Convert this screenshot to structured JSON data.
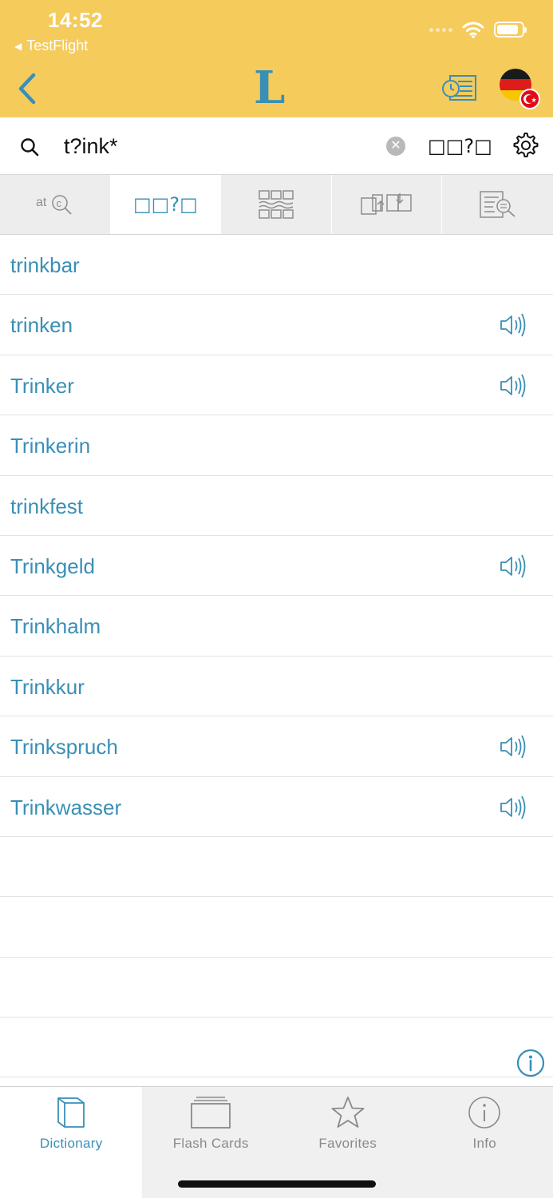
{
  "status_bar": {
    "time": "14:52",
    "back_app": "TestFlight"
  },
  "header": {
    "logo": "L",
    "back_icon": "chevron-left-icon",
    "history_icon": "history-list-icon",
    "language_flags": [
      "de",
      "tr"
    ]
  },
  "search": {
    "query": "t?ink*",
    "mode_label": "□□?□"
  },
  "tabs": [
    {
      "name": "tab-spelling-search",
      "icon": "abc-search-icon"
    },
    {
      "name": "tab-wildcard",
      "label": "□□?□",
      "active": true
    },
    {
      "name": "tab-fulltext",
      "icon": "grid-wave-icon"
    },
    {
      "name": "tab-translation",
      "icon": "translate-icon"
    },
    {
      "name": "tab-text-search",
      "icon": "document-search-icon"
    }
  ],
  "results": [
    {
      "word": "trinkbar",
      "audio": false
    },
    {
      "word": "trinken",
      "audio": true
    },
    {
      "word": "Trinker",
      "audio": true
    },
    {
      "word": "Trinkerin",
      "audio": false
    },
    {
      "word": "trinkfest",
      "audio": false
    },
    {
      "word": "Trinkgeld",
      "audio": true
    },
    {
      "word": "Trinkhalm",
      "audio": false
    },
    {
      "word": "Trinkkur",
      "audio": false
    },
    {
      "word": "Trinkspruch",
      "audio": true
    },
    {
      "word": "Trinkwasser",
      "audio": true
    }
  ],
  "tabbar": [
    {
      "label": "Dictionary",
      "icon": "dictionary-icon",
      "active": true
    },
    {
      "label": "Flash Cards",
      "icon": "flash-cards-icon"
    },
    {
      "label": "Favorites",
      "icon": "star-icon"
    },
    {
      "label": "Info",
      "icon": "info-icon"
    }
  ],
  "colors": {
    "header": "#f5cb5c",
    "accent": "#3a8fb5",
    "inactive": "#8a8a8a"
  }
}
